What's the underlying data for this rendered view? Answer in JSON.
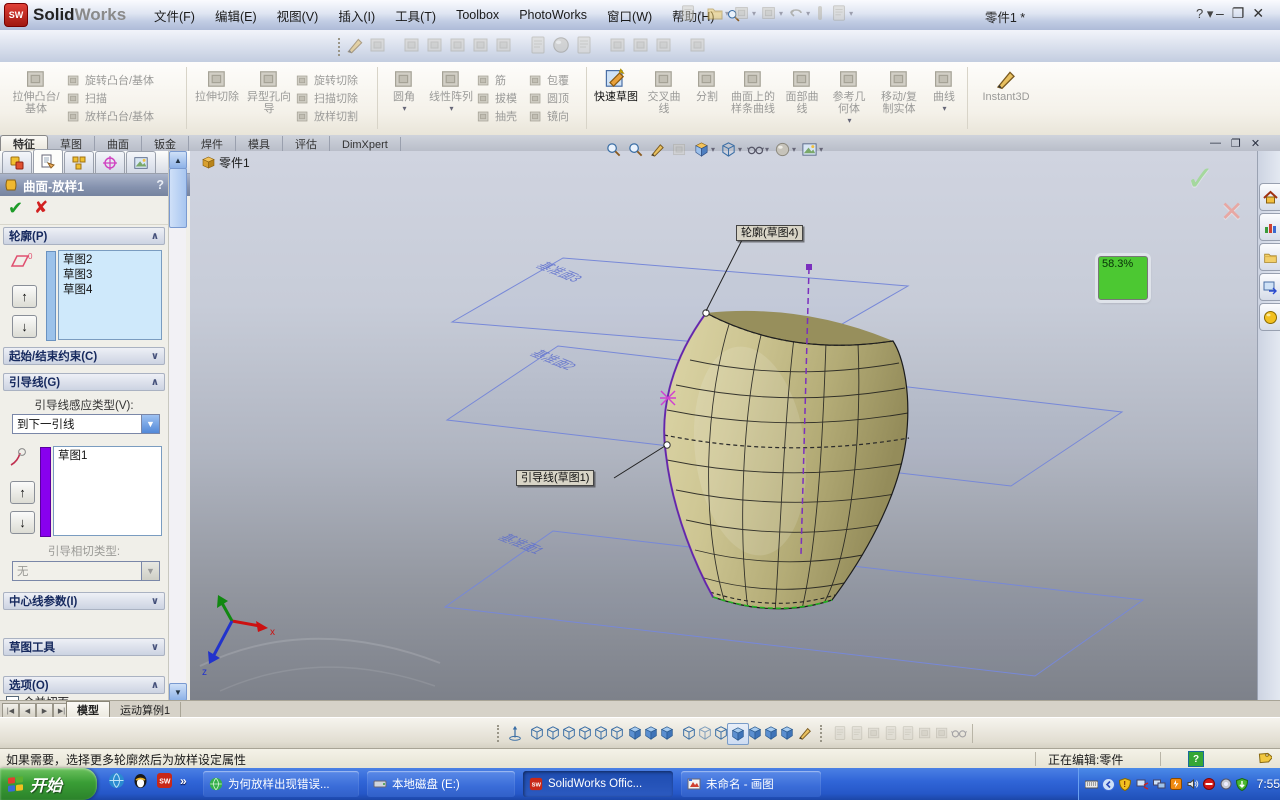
{
  "titlebar": {
    "logo_badge": "SW",
    "logo_solid": "Solid",
    "logo_works": "Works",
    "menus": [
      "文件(F)",
      "编辑(E)",
      "视图(V)",
      "插入(I)",
      "工具(T)",
      "Toolbox",
      "PhotoWorks",
      "窗口(W)",
      "帮助(H)"
    ],
    "doc_title": "零件1 *",
    "help_glyph": "?",
    "win_min": "–",
    "win_restore": "❐",
    "win_close": "✕"
  },
  "ribbon": {
    "g1_big": "拉伸凸台/基体",
    "g1_rows": [
      "旋转凸台/基体",
      "扫描",
      "放样凸台/基体"
    ],
    "g2_big1": "拉伸切除",
    "g2_big2": "异型孔向导",
    "g2_rows": [
      "旋转切除",
      "扫描切除",
      "放样切割"
    ],
    "g3_big1": "圆角",
    "g3_big2": "线性阵列",
    "g3_rows1": [
      "筋",
      "拔模",
      "抽壳"
    ],
    "g3_rows2": [
      "包覆",
      "圆顶",
      "镜向"
    ],
    "g4": [
      "快速草图",
      "交叉曲线",
      "分割",
      "曲面上的样条曲线",
      "面部曲线",
      "参考几何体",
      "移动/复制实体",
      "曲线",
      "Instant3D"
    ]
  },
  "cm_tabs": [
    "特征",
    "草图",
    "曲面",
    "钣金",
    "焊件",
    "模具",
    "评估",
    "DimXpert"
  ],
  "pm": {
    "title": "曲面-放样1",
    "help": "?",
    "ok": "✔",
    "cancel": "✘",
    "sec_profiles": "轮廓(P)",
    "profiles": [
      "草图2",
      "草图3",
      "草图4"
    ],
    "sec_constraints": "起始/结束约束(C)",
    "sec_guides": "引导线(G)",
    "guide_type_label": "引导线感应类型(V):",
    "guide_type_value": "到下一引线",
    "guides": [
      "草图1"
    ],
    "guide_tangency_label": "引导相切类型:",
    "guide_tangency_value": "无",
    "sec_centerline": "中心线参数(I)",
    "sec_sketch_tools": "草图工具",
    "sec_options": "选项(O)",
    "option_merge": "合并切面",
    "chev_up": "∧",
    "chev_down": "∨",
    "arrow_up": "↑",
    "arrow_down": "↓"
  },
  "viewport": {
    "part_label": "零件1",
    "callout_profile": "轮廓(草图4)",
    "callout_guide": "引导线(草图1)",
    "zoom_badge": "58.3%",
    "plane_labels": [
      "基准面3",
      "基准面2",
      "基准面1"
    ],
    "triad_x": "x",
    "triad_z": "z",
    "confirm_check": "✓",
    "confirm_cancel": "✕"
  },
  "doc_tabs": {
    "model": "模型",
    "motion": "运动算例1"
  },
  "status": {
    "message": "如果需要，选择更多轮廓然后为放样设定属性",
    "editing": "正在编辑:零件",
    "help_glyph": "?"
  },
  "taskbar": {
    "start": "开始",
    "quick_more": "»",
    "tasks": [
      {
        "title": "为何放样出现错误..."
      },
      {
        "title": "本地磁盘 (E:)"
      },
      {
        "title": "SolidWorks Offic..."
      },
      {
        "title": "未命名 - 画图"
      }
    ],
    "time": "7:55"
  },
  "colors": {
    "zoom_badge_green": "#4cc832",
    "guide_purple": "#7b2fbe",
    "plane_blue": "#7788dd",
    "vase_khaki": "#c5bd88",
    "taskbar_blue": "#3166d8",
    "start_green": "#3a9e36"
  }
}
